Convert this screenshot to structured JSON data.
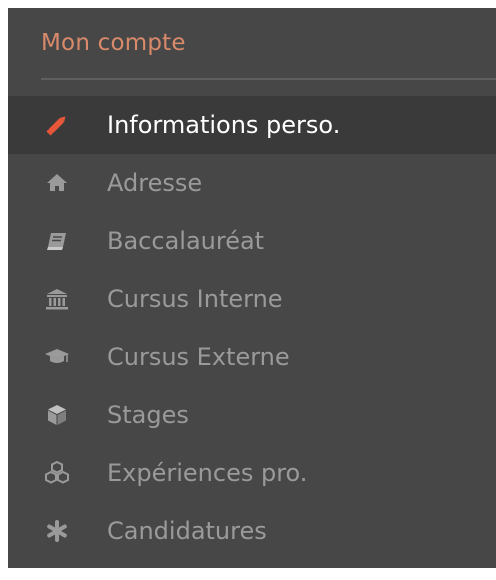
{
  "panel": {
    "title": "Mon compte"
  },
  "menu": {
    "items": [
      {
        "label": "Informations perso.",
        "icon": "pencil-icon",
        "active": true
      },
      {
        "label": "Adresse",
        "icon": "home-icon",
        "active": false
      },
      {
        "label": "Baccalauréat",
        "icon": "book-icon",
        "active": false
      },
      {
        "label": "Cursus Interne",
        "icon": "institution-icon",
        "active": false
      },
      {
        "label": "Cursus Externe",
        "icon": "graduation-cap-icon",
        "active": false
      },
      {
        "label": "Stages",
        "icon": "cube-icon",
        "active": false
      },
      {
        "label": "Expériences pro.",
        "icon": "cubes-icon",
        "active": false
      },
      {
        "label": "Candidatures",
        "icon": "asterisk-icon",
        "active": false
      }
    ]
  },
  "colors": {
    "panel_bg": "#474747",
    "active_bg": "#3a3a3a",
    "header_accent": "#d98a6a",
    "active_icon": "#e8573a",
    "active_text": "#ffffff",
    "inactive_text": "#9a9a9a"
  }
}
